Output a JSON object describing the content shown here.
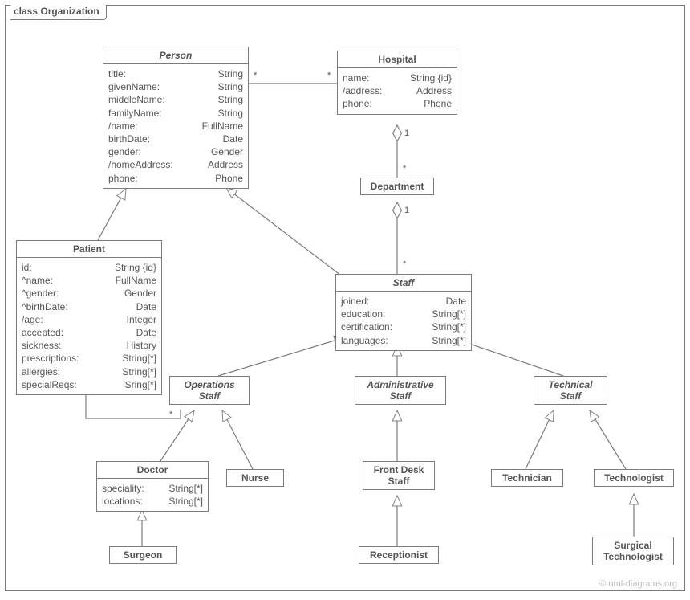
{
  "frame_title": "class Organization",
  "watermark": "© uml-diagrams.org",
  "classes": {
    "person": {
      "name": "Person",
      "attrs": [
        {
          "n": "title:",
          "t": "String"
        },
        {
          "n": "givenName:",
          "t": "String"
        },
        {
          "n": "middleName:",
          "t": "String"
        },
        {
          "n": "familyName:",
          "t": "String"
        },
        {
          "n": "/name:",
          "t": "FullName"
        },
        {
          "n": "birthDate:",
          "t": "Date"
        },
        {
          "n": "gender:",
          "t": "Gender"
        },
        {
          "n": "/homeAddress:",
          "t": "Address"
        },
        {
          "n": "phone:",
          "t": "Phone"
        }
      ]
    },
    "hospital": {
      "name": "Hospital",
      "attrs": [
        {
          "n": "name:",
          "t": "String {id}"
        },
        {
          "n": "/address:",
          "t": "Address"
        },
        {
          "n": "phone:",
          "t": "Phone"
        }
      ]
    },
    "department": {
      "name": "Department"
    },
    "patient": {
      "name": "Patient",
      "attrs": [
        {
          "n": "id:",
          "t": "String {id}"
        },
        {
          "n": "^name:",
          "t": "FullName"
        },
        {
          "n": "^gender:",
          "t": "Gender"
        },
        {
          "n": "^birthDate:",
          "t": "Date"
        },
        {
          "n": "/age:",
          "t": "Integer"
        },
        {
          "n": "accepted:",
          "t": "Date"
        },
        {
          "n": "sickness:",
          "t": "History"
        },
        {
          "n": "prescriptions:",
          "t": "String[*]"
        },
        {
          "n": "allergies:",
          "t": "String[*]"
        },
        {
          "n": "specialReqs:",
          "t": "Sring[*]"
        }
      ]
    },
    "staff": {
      "name": "Staff",
      "attrs": [
        {
          "n": "joined:",
          "t": "Date"
        },
        {
          "n": "education:",
          "t": "String[*]"
        },
        {
          "n": "certification:",
          "t": "String[*]"
        },
        {
          "n": "languages:",
          "t": "String[*]"
        }
      ]
    },
    "ops": {
      "name": "Operations",
      "sub": "Staff"
    },
    "admin": {
      "name": "Administrative",
      "sub": "Staff"
    },
    "tech": {
      "name": "Technical",
      "sub": "Staff"
    },
    "doctor": {
      "name": "Doctor",
      "attrs": [
        {
          "n": "speciality:",
          "t": "String[*]"
        },
        {
          "n": "locations:",
          "t": "String[*]"
        }
      ]
    },
    "nurse": {
      "name": "Nurse"
    },
    "fds": {
      "name": "Front Desk",
      "sub": "Staff"
    },
    "technician": {
      "name": "Technician"
    },
    "technologist": {
      "name": "Technologist"
    },
    "surgeon": {
      "name": "Surgeon"
    },
    "receptionist": {
      "name": "Receptionist"
    },
    "surgtech": {
      "name": "Surgical",
      "sub": "Technologist"
    }
  },
  "mult": {
    "person_hospital_left": "*",
    "person_hospital_right": "*",
    "hospital_dept_top": "1",
    "hospital_dept_bottom": "*",
    "dept_staff_top": "1",
    "dept_staff_bottom": "*",
    "patient_ops_left": "*",
    "patient_ops_right": "*"
  }
}
